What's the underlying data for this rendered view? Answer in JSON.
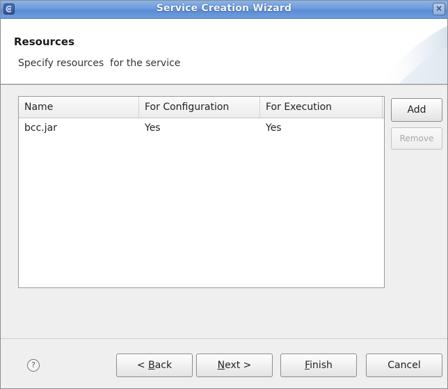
{
  "window": {
    "title": "Service Creation Wizard",
    "close_glyph": "×"
  },
  "header": {
    "title": "Resources",
    "subtitle": "Specify resources  for the service"
  },
  "table": {
    "columns": [
      "Name",
      "For Configuration",
      "For Execution"
    ],
    "rows": [
      {
        "name": "bcc.jar",
        "for_configuration": "Yes",
        "for_execution": "Yes"
      }
    ]
  },
  "side_buttons": {
    "add": "Add",
    "remove": "Remove",
    "remove_enabled": false
  },
  "footer": {
    "help_glyph": "?",
    "back_prefix": "< ",
    "back_mnemonic": "B",
    "back_rest": "ack",
    "next_mnemonic": "N",
    "next_rest": "ext >",
    "finish_mnemonic": "F",
    "finish_rest": "inish",
    "cancel": "Cancel"
  },
  "icons": {
    "app": "app-window-icon",
    "close": "close-icon",
    "help": "help-icon"
  },
  "colors": {
    "titlebar": "#6d9bdc",
    "title_text": "#f2f6ff",
    "window_bg": "#efefef"
  }
}
